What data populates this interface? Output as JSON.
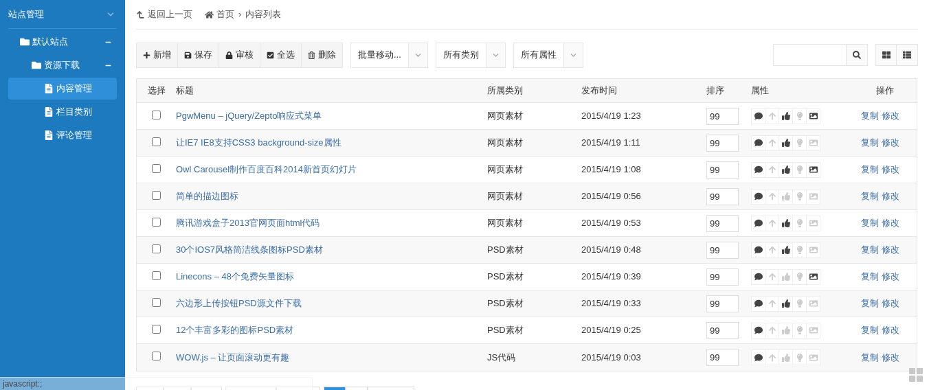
{
  "sidebar": {
    "title": "站点管理",
    "expanded": true,
    "tree": [
      {
        "label": "默认站点",
        "kind": "folder",
        "expanded": true,
        "selected": false,
        "children": [
          {
            "label": "资源下载",
            "kind": "folder",
            "expanded": true,
            "selected": false,
            "children": [
              {
                "label": "内容管理",
                "kind": "page",
                "selected": true
              },
              {
                "label": "栏目类别",
                "kind": "page",
                "selected": false
              },
              {
                "label": "评论管理",
                "kind": "page",
                "selected": false
              }
            ]
          }
        ]
      }
    ]
  },
  "breadcrumb": {
    "back": "返回上一页",
    "home": "首页",
    "separator": "›",
    "current": "内容列表"
  },
  "toolbar": {
    "buttons": [
      {
        "label": "新增",
        "kind": "add"
      },
      {
        "label": "保存",
        "kind": "save"
      },
      {
        "label": "审核",
        "kind": "lock"
      },
      {
        "label": "全选",
        "kind": "check"
      },
      {
        "label": "删除",
        "kind": "delete"
      }
    ],
    "dropdowns": [
      {
        "label": "批量移动..."
      },
      {
        "label": "所有类别"
      },
      {
        "label": "所有属性"
      }
    ]
  },
  "table": {
    "columns": [
      "选择",
      "标题",
      "所属类别",
      "发布时间",
      "排序",
      "属性",
      "操作"
    ],
    "rows": [
      {
        "checked": false,
        "title": "PgwMenu – jQuery/Zepto响应式菜单",
        "category": "网页素材",
        "time": "2015/4/19 1:23",
        "sort": "99",
        "attrs": [
          true,
          false,
          true,
          false,
          true
        ],
        "actions": [
          "复制",
          "修改"
        ]
      },
      {
        "checked": false,
        "title": "让IE7 IE8支持CSS3 background-size属性",
        "category": "网页素材",
        "time": "2015/4/19 1:11",
        "sort": "99",
        "attrs": [
          true,
          false,
          true,
          false,
          false
        ],
        "actions": [
          "复制",
          "修改"
        ]
      },
      {
        "checked": false,
        "title": "Owl Carousel制作百度百科2014新首页幻灯片",
        "category": "网页素材",
        "time": "2015/4/19 1:08",
        "sort": "99",
        "attrs": [
          true,
          false,
          true,
          false,
          true
        ],
        "actions": [
          "复制",
          "修改"
        ]
      },
      {
        "checked": false,
        "title": "简单的描边图标",
        "category": "网页素材",
        "time": "2015/4/19 0:56",
        "sort": "99",
        "attrs": [
          true,
          false,
          false,
          false,
          false
        ],
        "actions": [
          "复制",
          "修改"
        ]
      },
      {
        "checked": false,
        "title": "腾讯游戏盒子2013官网页面html代码",
        "category": "网页素材",
        "time": "2015/4/19 0:53",
        "sort": "99",
        "attrs": [
          true,
          false,
          true,
          false,
          false
        ],
        "actions": [
          "复制",
          "修改"
        ]
      },
      {
        "checked": false,
        "title": "30个IOS7风格简洁线条图标PSD素材",
        "category": "PSD素材",
        "time": "2015/4/19 0:48",
        "sort": "99",
        "attrs": [
          true,
          false,
          true,
          false,
          false
        ],
        "actions": [
          "复制",
          "修改"
        ]
      },
      {
        "checked": false,
        "title": "Linecons – 48个免费矢量图标",
        "category": "PSD素材",
        "time": "2015/4/19 0:39",
        "sort": "99",
        "attrs": [
          true,
          false,
          false,
          false,
          true
        ],
        "actions": [
          "复制",
          "修改"
        ]
      },
      {
        "checked": false,
        "title": "六边形上传按钮PSD源文件下载",
        "category": "PSD素材",
        "time": "2015/4/19 0:33",
        "sort": "99",
        "attrs": [
          true,
          false,
          true,
          false,
          false
        ],
        "actions": [
          "复制",
          "修改"
        ]
      },
      {
        "checked": false,
        "title": "12个丰富多彩的图标PSD素材",
        "category": "PSD素材",
        "time": "2015/4/19 0:25",
        "sort": "99",
        "attrs": [
          true,
          false,
          false,
          false,
          false
        ],
        "actions": [
          "复制",
          "修改"
        ]
      },
      {
        "checked": false,
        "title": "WOW.js – 让页面滚动更有趣",
        "category": "JS代码",
        "time": "2015/4/19 0:03",
        "sort": "99",
        "attrs": [
          true,
          false,
          false,
          false,
          false
        ],
        "actions": [
          "复制",
          "修改"
        ]
      }
    ]
  },
  "pagination": [
    {
      "selected": false
    },
    {
      "selected": false
    },
    {
      "selected": false
    },
    {
      "selected": false
    },
    {
      "selected": false
    },
    {
      "selected": true
    },
    {
      "selected": false
    },
    {
      "selected": false
    }
  ],
  "status_bar": "javascript:;"
}
